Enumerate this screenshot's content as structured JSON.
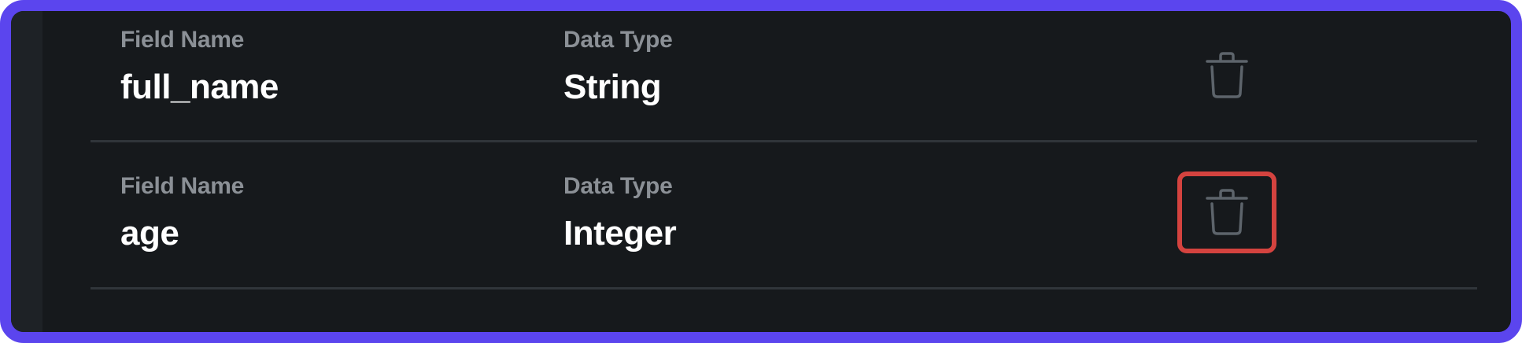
{
  "fields": [
    {
      "field_name_label": "Field Name",
      "field_name": "full_name",
      "data_type_label": "Data Type",
      "data_type": "String",
      "delete_icon": "trash-icon",
      "highlighted": false
    },
    {
      "field_name_label": "Field Name",
      "field_name": "age",
      "data_type_label": "Data Type",
      "data_type": "Integer",
      "delete_icon": "trash-icon",
      "highlighted": true
    }
  ],
  "colors": {
    "frame_border": "#5b45ee",
    "background": "#16191c",
    "highlight": "#d4433f",
    "label": "#8b9096",
    "value": "#ffffff",
    "icon": "#5d646b"
  }
}
